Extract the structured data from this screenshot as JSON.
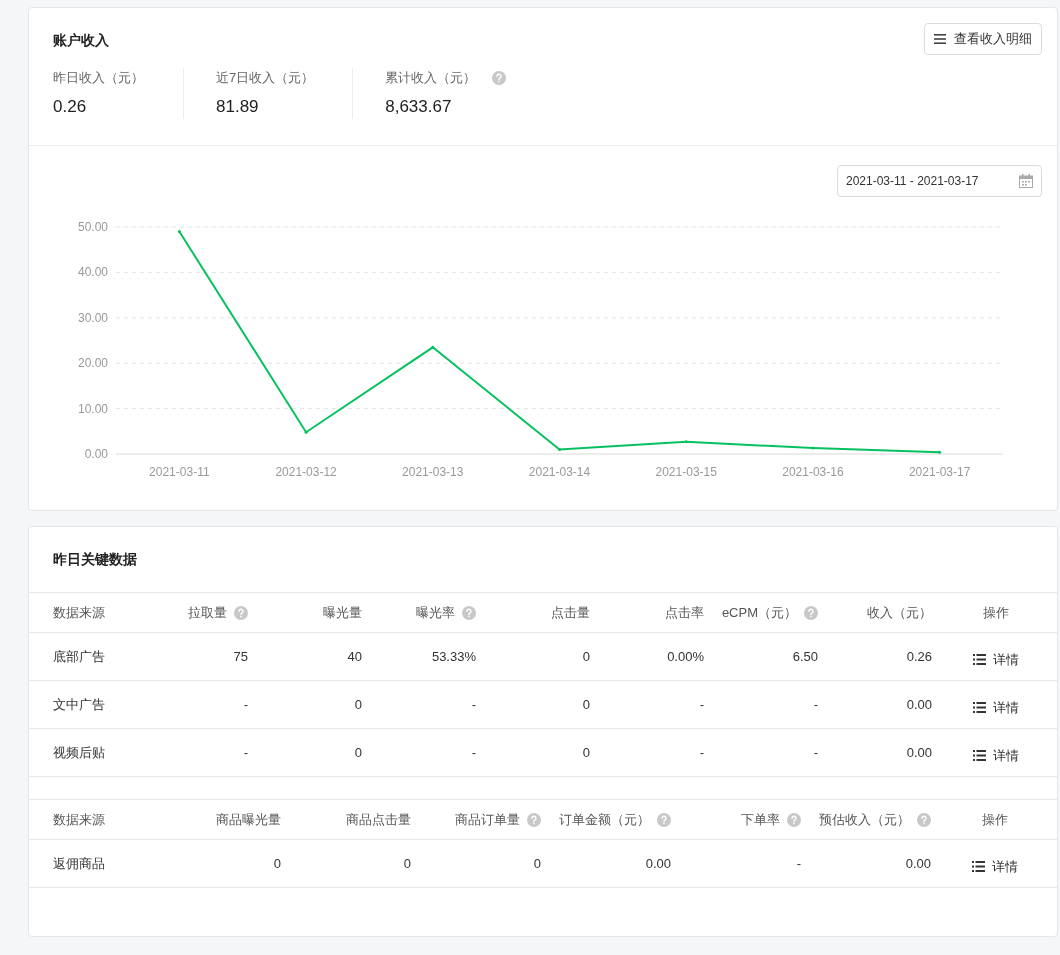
{
  "income_card": {
    "title": "账户收入",
    "detail_button": "查看收入明细",
    "stats": [
      {
        "label": "昨日收入（元）",
        "value": "0.26",
        "help": false
      },
      {
        "label": "近7日收入（元）",
        "value": "81.89",
        "help": false
      },
      {
        "label": "累计收入（元）",
        "value": "8,633.67",
        "help": true
      }
    ],
    "date_range": "2021-03-11 - 2021-03-17",
    "chart_data": {
      "type": "line",
      "categories": [
        "2021-03-11",
        "2021-03-12",
        "2021-03-13",
        "2021-03-14",
        "2021-03-15",
        "2021-03-16",
        "2021-03-17"
      ],
      "grid": true,
      "series": [
        {
          "color": "#07c160",
          "values": [
            49.0,
            4.8,
            23.5,
            1.0,
            2.7,
            1.3,
            0.4
          ]
        }
      ],
      "ylim": [
        0,
        50
      ],
      "yticks": [
        {
          "value": 0,
          "label": "0.00"
        },
        {
          "value": 10,
          "label": "10.00"
        },
        {
          "value": 20,
          "label": "20.00"
        },
        {
          "value": 30,
          "label": "30.00"
        },
        {
          "value": 40,
          "label": "40.00"
        },
        {
          "value": 50,
          "label": "50.00"
        }
      ]
    }
  },
  "key_data_card": {
    "title": "昨日关键数据",
    "tables": [
      {
        "columns": [
          {
            "label": "数据来源",
            "help": false
          },
          {
            "label": "拉取量",
            "help": true
          },
          {
            "label": "曝光量",
            "help": false
          },
          {
            "label": "曝光率",
            "help": true
          },
          {
            "label": "点击量",
            "help": false
          },
          {
            "label": "点击率",
            "help": false
          },
          {
            "label": "eCPM（元）",
            "help": true
          },
          {
            "label": "收入（元）",
            "help": false
          },
          {
            "label": "操作",
            "help": false
          }
        ],
        "rows": [
          {
            "cells": [
              "底部广告",
              "75",
              "40",
              "53.33%",
              "0",
              "0.00%",
              "6.50",
              "0.26"
            ],
            "action": "详情"
          },
          {
            "cells": [
              "文中广告",
              "-",
              "0",
              "-",
              "0",
              "-",
              "-",
              "0.00"
            ],
            "action": "详情"
          },
          {
            "cells": [
              "视频后贴",
              "-",
              "0",
              "-",
              "0",
              "-",
              "-",
              "0.00"
            ],
            "action": "详情"
          }
        ]
      },
      {
        "columns": [
          {
            "label": "数据来源",
            "help": false
          },
          {
            "label": "商品曝光量",
            "help": false
          },
          {
            "label": "商品点击量",
            "help": false
          },
          {
            "label": "商品订单量",
            "help": true
          },
          {
            "label": "订单金额（元）",
            "help": true
          },
          {
            "label": "下单率",
            "help": true
          },
          {
            "label": "预估收入（元）",
            "help": true
          },
          {
            "label": "操作",
            "help": false
          }
        ],
        "rows": [
          {
            "cells": [
              "返佣商品",
              "0",
              "0",
              "0",
              "0.00",
              "-",
              "0.00"
            ],
            "action": "详情"
          }
        ]
      }
    ]
  }
}
